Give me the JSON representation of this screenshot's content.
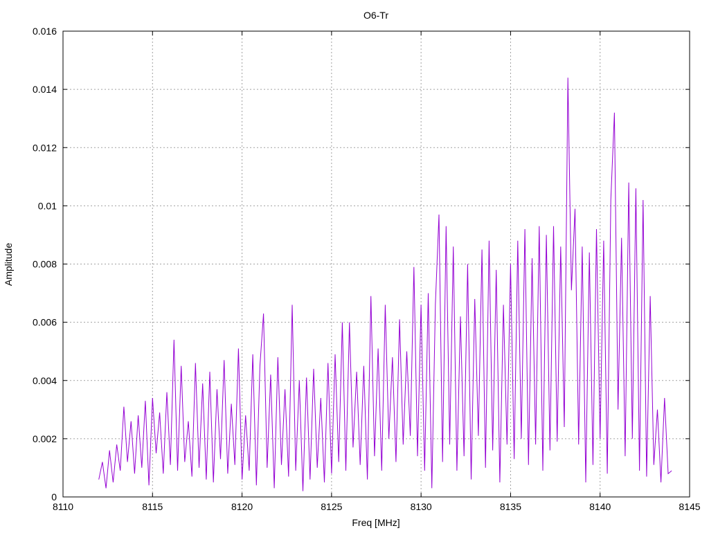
{
  "chart_data": {
    "type": "line",
    "title": "O6-Tr",
    "xlabel": "Freq [MHz]",
    "ylabel": "Amplitude",
    "xlim": [
      8110,
      8145
    ],
    "ylim": [
      0,
      0.016
    ],
    "x_ticks": [
      "8110",
      "8115",
      "8120",
      "8125",
      "8130",
      "8135",
      "8140",
      "8145"
    ],
    "y_ticks": [
      "0",
      "0.002",
      "0.004",
      "0.006",
      "0.008",
      "0.01",
      "0.012",
      "0.014",
      "0.016"
    ],
    "grid": true,
    "series": [
      {
        "name": "O6-Tr",
        "color": "#9400d3",
        "x_start": 8112.0,
        "x_step": 0.2,
        "values": [
          0.0006,
          0.0012,
          0.0003,
          0.0016,
          0.0005,
          0.0018,
          0.0009,
          0.0031,
          0.0012,
          0.0026,
          0.0008,
          0.0028,
          0.001,
          0.0033,
          0.0004,
          0.0034,
          0.0015,
          0.0029,
          0.0008,
          0.0036,
          0.0011,
          0.0054,
          0.0009,
          0.0045,
          0.0012,
          0.0026,
          0.0007,
          0.0046,
          0.001,
          0.0039,
          0.0006,
          0.0043,
          0.0005,
          0.0037,
          0.0013,
          0.0047,
          0.0008,
          0.0032,
          0.0011,
          0.0051,
          0.0006,
          0.0028,
          0.0009,
          0.0049,
          0.0004,
          0.0045,
          0.0063,
          0.001,
          0.0042,
          0.0003,
          0.0048,
          0.0011,
          0.0037,
          0.0007,
          0.0066,
          0.0009,
          0.004,
          0.0002,
          0.0041,
          0.0006,
          0.0044,
          0.001,
          0.0034,
          0.0005,
          0.0046,
          0.0008,
          0.0049,
          0.0012,
          0.006,
          0.0009,
          0.006,
          0.0017,
          0.0043,
          0.0011,
          0.0045,
          0.0006,
          0.0069,
          0.0014,
          0.0051,
          0.0009,
          0.0066,
          0.002,
          0.0048,
          0.0012,
          0.0061,
          0.0018,
          0.005,
          0.0021,
          0.0079,
          0.0014,
          0.0066,
          0.0009,
          0.007,
          0.0003,
          0.0066,
          0.0097,
          0.0012,
          0.0093,
          0.0018,
          0.0086,
          0.0009,
          0.0062,
          0.0014,
          0.008,
          0.0006,
          0.0068,
          0.0021,
          0.0085,
          0.001,
          0.0088,
          0.0016,
          0.0078,
          0.0005,
          0.0066,
          0.0018,
          0.008,
          0.0013,
          0.0088,
          0.002,
          0.0092,
          0.0011,
          0.0082,
          0.0018,
          0.0093,
          0.0009,
          0.009,
          0.0016,
          0.0093,
          0.0019,
          0.0086,
          0.0024,
          0.0144,
          0.0071,
          0.0099,
          0.0018,
          0.0086,
          0.0005,
          0.0084,
          0.0011,
          0.0092,
          0.002,
          0.0088,
          0.0008,
          0.0102,
          0.0132,
          0.003,
          0.0089,
          0.0014,
          0.0108,
          0.002,
          0.0106,
          0.0009,
          0.0102,
          0.0007,
          0.0069,
          0.0011,
          0.003,
          0.0005,
          0.0034,
          0.0008,
          0.0009
        ]
      }
    ]
  }
}
